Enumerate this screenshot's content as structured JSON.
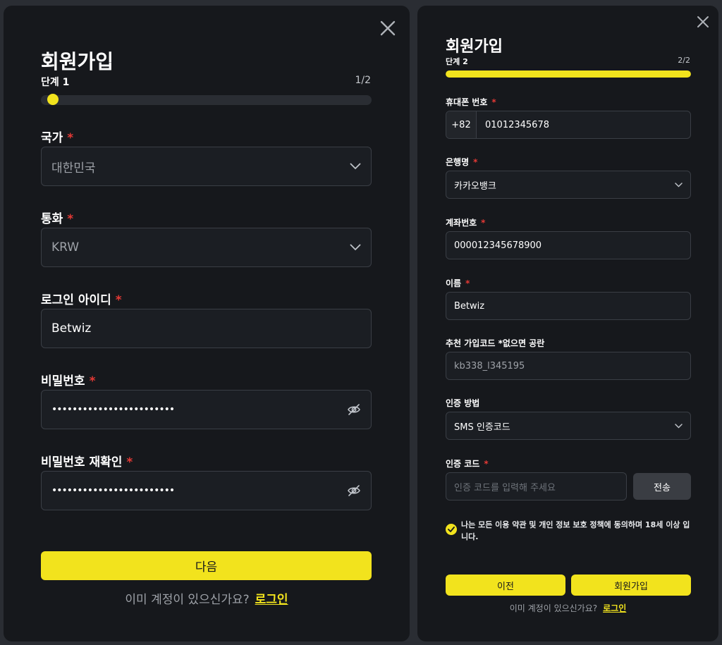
{
  "step1": {
    "title": "회원가입",
    "step_label": "단계 1",
    "step_count": "1/2",
    "progress": 0.02,
    "fields": {
      "country": {
        "label": "국가",
        "value": "대한민국"
      },
      "currency": {
        "label": "통화",
        "value": "KRW"
      },
      "login_id": {
        "label": "로그인 아이디",
        "value": "Betwiz"
      },
      "password": {
        "label": "비밀번호",
        "value": "••••••••••••••••••••••••"
      },
      "password_confirm": {
        "label": "비밀번호 재확인",
        "value": "••••••••••••••••••••••••"
      }
    },
    "required_mark": "*",
    "next_button": "다음",
    "footer_text": "이미 계정이 있으신가요?",
    "footer_link": "로그인"
  },
  "step2": {
    "title": "회원가입",
    "step_label": "단계 2",
    "step_count": "2/2",
    "progress": 1.0,
    "required_mark": "*",
    "fields": {
      "phone": {
        "label": "휴대폰 번호",
        "prefix": "+82",
        "value": "01012345678"
      },
      "bank": {
        "label": "은행명",
        "value": "카카오뱅크"
      },
      "account": {
        "label": "계좌번호",
        "value": "000012345678900"
      },
      "name": {
        "label": "이름",
        "value": "Betwiz"
      },
      "referral": {
        "label": "추천 가입코드 *없으면 공란",
        "value": "kb338_l345195"
      },
      "verify_method": {
        "label": "인증 방법",
        "value": "SMS 인증코드"
      },
      "verify_code": {
        "label": "인증 코드",
        "placeholder": "인증 코드를 입력해 주세요",
        "send_button": "전송"
      }
    },
    "agree_text": "나는 모든 이용 약관 및 개인 정보 보호 정책에 동의하며 18세 이상 입니다.",
    "agree_checked": true,
    "prev_button": "이전",
    "signup_button": "회원가입",
    "footer_text": "이미 계정이 있으신가요?",
    "footer_link": "로그인"
  },
  "colors": {
    "accent": "#f2e31d",
    "panel_bg": "#16181c",
    "page_bg": "#2a2d33",
    "required": "#e53935"
  },
  "icons": {
    "close": "close-icon",
    "chevron": "chevron-down-icon",
    "eye_hidden": "eye-off-icon",
    "check": "check-icon"
  }
}
